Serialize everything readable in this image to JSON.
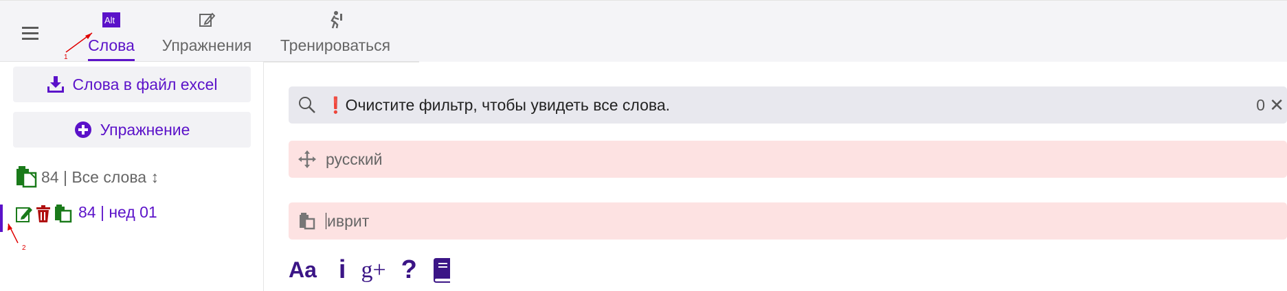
{
  "tabs": [
    {
      "label": "Слова",
      "icon": "alt-text-icon",
      "active": true
    },
    {
      "label": "Упражнения",
      "icon": "edit-icon",
      "active": false
    },
    {
      "label": "Тренироваться",
      "icon": "exercise-icon",
      "active": false
    }
  ],
  "sidebar": {
    "export_label": "Слова в файл excel",
    "exercise_label": "Упражнение",
    "all_words_label": "84 | Все слова ↕",
    "list_item_label": "84 | нед 01"
  },
  "search": {
    "warning": "❗",
    "text": "Очистите фильтр, чтобы увидеть все слова.",
    "count": "0",
    "clear": "✕"
  },
  "fields": {
    "russian_placeholder": "русский",
    "hebrew_placeholder": "иврит"
  },
  "toolbar": {
    "font_label": "Aa",
    "info_label": "i",
    "gplus_label": "g+",
    "help_label": "?"
  },
  "annotations": {
    "one": "1",
    "two": "2"
  },
  "colors": {
    "accent": "#5b12c9",
    "green": "#1a7a1a",
    "red": "#b01010",
    "pink": "#fde2e2"
  }
}
